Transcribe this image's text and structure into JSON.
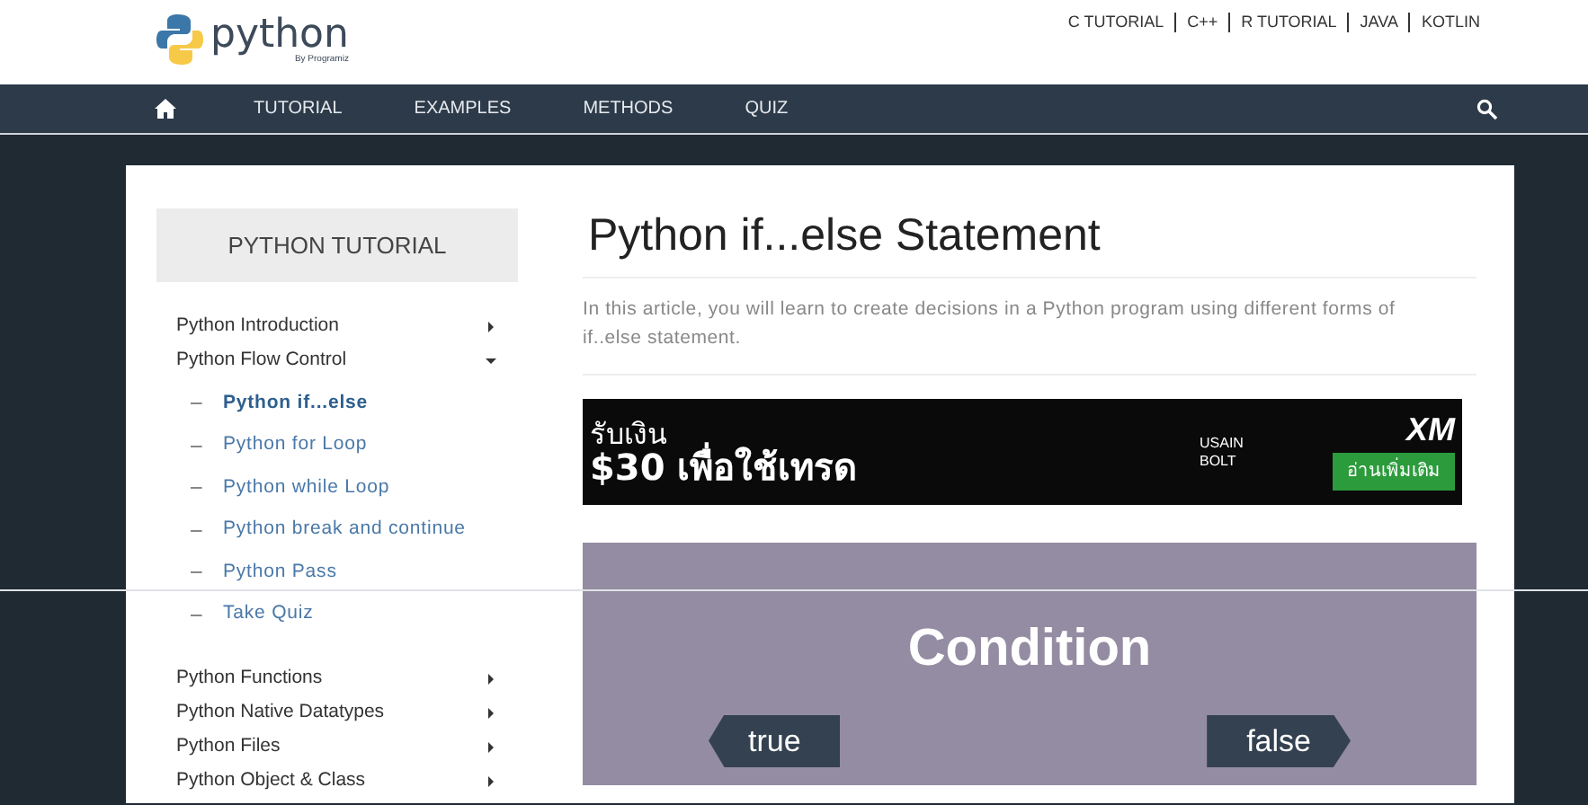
{
  "header": {
    "logo": {
      "wordmark": "python",
      "tagline": "By Programiz"
    },
    "top_links": [
      "C TUTORIAL",
      "C++",
      "R TUTORIAL",
      "JAVA",
      "KOTLIN"
    ]
  },
  "nav": {
    "items": [
      "TUTORIAL",
      "EXAMPLES",
      "METHODS",
      "QUIZ"
    ]
  },
  "sidebar": {
    "title": "PYTHON TUTORIAL",
    "items": [
      {
        "label": "Python Introduction",
        "expanded": false
      },
      {
        "label": "Python Flow Control",
        "expanded": true,
        "children": [
          {
            "label": "Python if...else",
            "selected": true
          },
          {
            "label": "Python for Loop",
            "selected": false
          },
          {
            "label": "Python while Loop",
            "selected": false
          },
          {
            "label": "Python break and continue",
            "selected": false
          },
          {
            "label": "Python Pass",
            "selected": false
          },
          {
            "label": "Take Quiz",
            "selected": false
          }
        ]
      },
      {
        "label": "Python Functions",
        "expanded": false
      },
      {
        "label": "Python Native Datatypes",
        "expanded": false
      },
      {
        "label": "Python Files",
        "expanded": false
      },
      {
        "label": "Python Object & Class",
        "expanded": false
      }
    ]
  },
  "article": {
    "title": "Python if...else Statement",
    "intro": "In this article, you will learn to create decisions in a Python program using different forms of if..else statement.",
    "ad": {
      "headline_1": "รับเงิน",
      "headline_2": "$30 เพื่อใช้เทรด",
      "sponsor": "USAIN BOLT",
      "brand": "XM",
      "button": "อ่านเพิ่มเติม"
    },
    "illustration": {
      "heading": "Condition",
      "left_sign": "true",
      "right_sign": "false"
    }
  }
}
